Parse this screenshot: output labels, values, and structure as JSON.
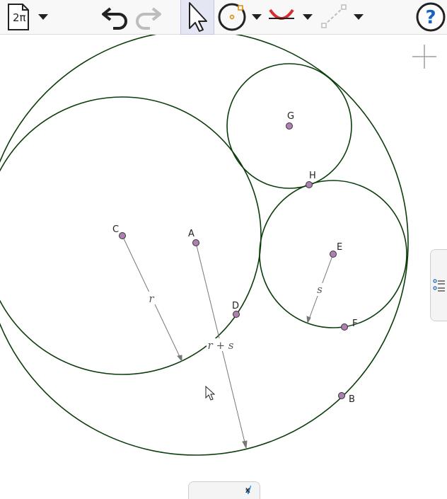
{
  "toolbar": {
    "file_label": "2π",
    "tools": [
      {
        "name": "file-menu",
        "icon": "file-icon"
      },
      {
        "name": "undo",
        "icon": "undo-icon"
      },
      {
        "name": "redo",
        "icon": "redo-icon"
      },
      {
        "name": "move",
        "icon": "pointer-arrow-icon",
        "selected": true
      },
      {
        "name": "circle-tools",
        "icon": "circle-tool-icon"
      },
      {
        "name": "curve-tools",
        "icon": "arc-tool-icon"
      },
      {
        "name": "line-tools",
        "icon": "segment-tool-icon"
      },
      {
        "name": "help",
        "icon": "help-icon"
      }
    ]
  },
  "points": [
    "A",
    "B",
    "C",
    "D",
    "E",
    "F",
    "G",
    "H"
  ],
  "labels": {
    "r": "r",
    "s": "s",
    "r_plus_s": "r + s"
  },
  "algebra_tab": {
    "sqrt": "√",
    "var": "x"
  },
  "colors": {
    "circle_stroke": "#0b3d0b",
    "point_fill": "#b07fb2",
    "segment": "#777777",
    "selected_tool_bg": "#e4e6f4",
    "help_blue": "#1565c0",
    "curve_red": "#d32f2f"
  }
}
